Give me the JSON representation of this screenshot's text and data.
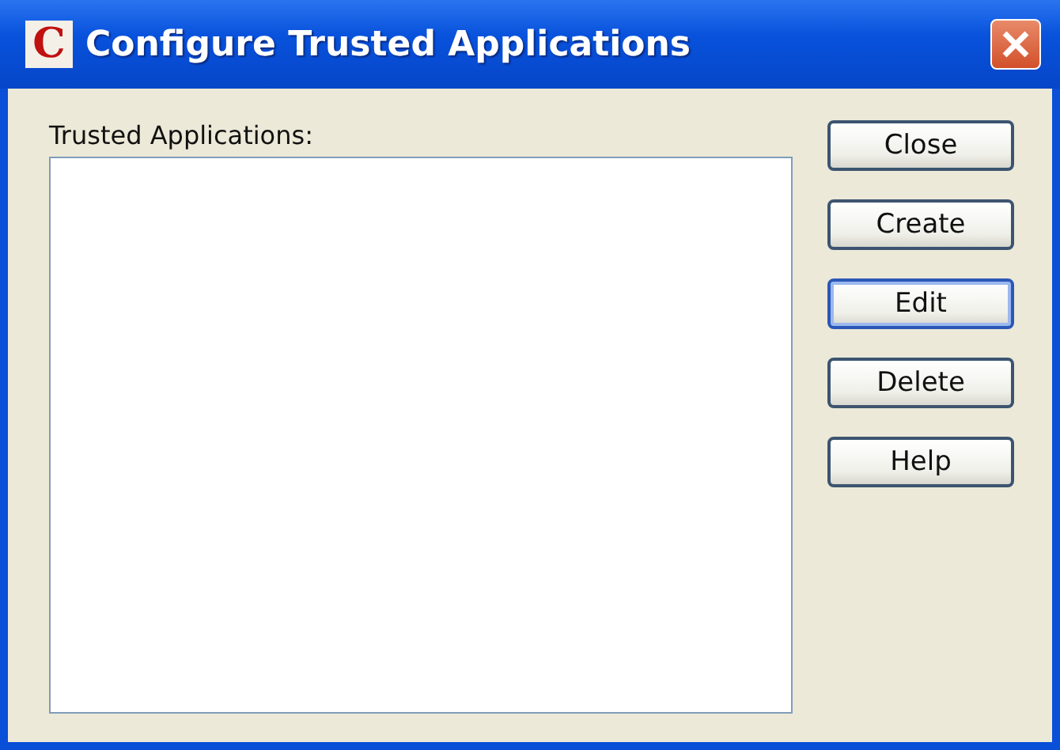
{
  "window": {
    "title": "Configure Trusted Applications",
    "icon_letter": "C"
  },
  "list": {
    "label": "Trusted Applications:"
  },
  "buttons": [
    {
      "label": "Close",
      "focused": false
    },
    {
      "label": "Create",
      "focused": false
    },
    {
      "label": "Edit",
      "focused": true
    },
    {
      "label": "Delete",
      "focused": false
    },
    {
      "label": "Help",
      "focused": false
    }
  ]
}
